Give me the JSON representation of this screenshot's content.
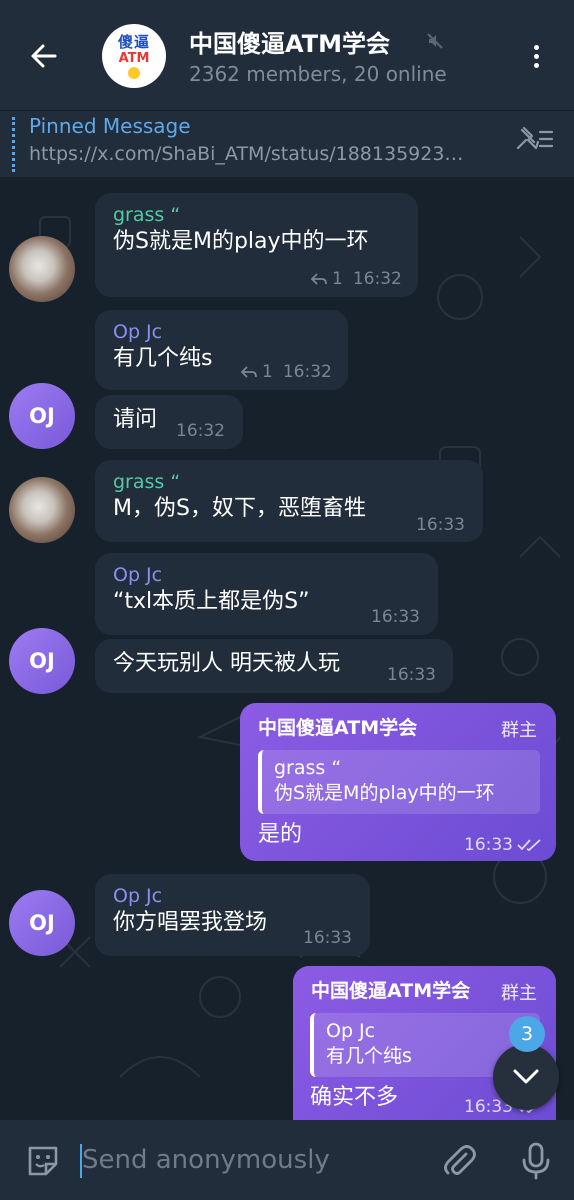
{
  "header": {
    "title": "中国傻逼ATM学会",
    "subtitle": "2362 members, 20 online",
    "avatar": {
      "line1": "傻逼",
      "line2": "ATM"
    }
  },
  "pinned": {
    "title": "Pinned Message",
    "text": "https://x.com/ShaBi_ATM/status/188135923…"
  },
  "messages": [
    {
      "sender": "grass “",
      "text": "伪S就是M的play中的一环",
      "replies": "1",
      "time": "16:32"
    },
    {
      "sender": "Op Jc",
      "text": "有几个纯s",
      "replies": "1",
      "time": "16:32"
    },
    {
      "text": "请问",
      "time": "16:32",
      "avatar": "OJ"
    },
    {
      "sender": "grass “",
      "text": "M，伪S，奴下，恶堕畜牲",
      "time": "16:33"
    },
    {
      "sender": "Op Jc",
      "text": "“txl本质上都是伪S”",
      "time": "16:33"
    },
    {
      "text": "今天玩别人 明天被人玩",
      "time": "16:33",
      "avatar": "OJ"
    },
    {
      "sender": "中国傻逼ATM学会",
      "badge": "群主",
      "quote_name": "grass “",
      "quote_text": "伪S就是M的play中的一环",
      "text": "是的",
      "time": "16:33"
    },
    {
      "sender": "Op Jc",
      "text": "你方唱罢我登场",
      "time": "16:33",
      "avatar": "OJ"
    },
    {
      "sender": "中国傻逼ATM学会",
      "badge": "群主",
      "quote_name": "Op Jc",
      "quote_text": "有几个纯s",
      "text": "确实不多",
      "time": "16:33"
    }
  ],
  "scroll": {
    "unread": "3"
  },
  "composer": {
    "placeholder": "Send anonymously"
  },
  "colors": {
    "accent": "#4ba7e6",
    "outgoing": "#7a56de",
    "incoming": "#212d3a"
  }
}
